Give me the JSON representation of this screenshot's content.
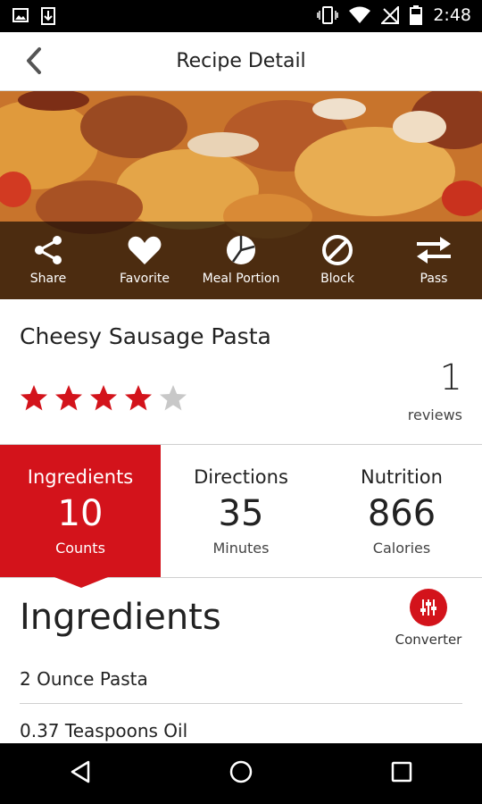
{
  "status_bar": {
    "time": "2:48",
    "left_icons": [
      "image-icon",
      "download-icon"
    ],
    "right_icons": [
      "vibrate-icon",
      "wifi-icon",
      "no-signal-icon",
      "battery-icon"
    ]
  },
  "app_bar": {
    "title": "Recipe Detail",
    "back_icon": "chevron-left-icon"
  },
  "actions": [
    {
      "label": "Share",
      "icon": "share-icon"
    },
    {
      "label": "Favorite",
      "icon": "heart-icon"
    },
    {
      "label": "Meal Portion",
      "icon": "pie-chart-icon"
    },
    {
      "label": "Block",
      "icon": "block-icon"
    },
    {
      "label": "Pass",
      "icon": "swap-arrows-icon"
    }
  ],
  "recipe": {
    "title": "Cheesy Sausage Pasta",
    "rating": 4,
    "rating_max": 5,
    "reviews_count": "1",
    "reviews_label": "reviews"
  },
  "tabs": [
    {
      "label": "Ingredients",
      "value": "10",
      "unit": "Counts",
      "active": true
    },
    {
      "label": "Directions",
      "value": "35",
      "unit": "Minutes",
      "active": false
    },
    {
      "label": "Nutrition",
      "value": "866",
      "unit": "Calories",
      "active": false
    }
  ],
  "ingredients_section": {
    "heading": "Ingredients",
    "converter_label": "Converter",
    "items": [
      "2 Ounce Pasta",
      "0.37 Teaspoons Oil"
    ]
  },
  "colors": {
    "accent": "#d3131b",
    "star_empty": "#c8c8c8"
  },
  "nav_bar": [
    "back-triangle-icon",
    "home-circle-icon",
    "recents-square-icon"
  ]
}
